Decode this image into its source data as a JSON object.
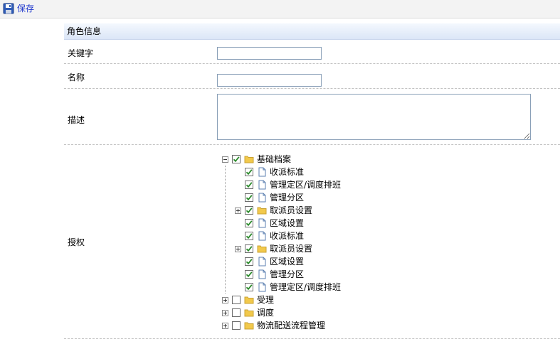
{
  "toolbar": {
    "save_label": "保存"
  },
  "section": {
    "title": "角色信息"
  },
  "fields": {
    "keyword": {
      "label": "关键字",
      "value": ""
    },
    "name": {
      "label": "名称",
      "value": ""
    },
    "description": {
      "label": "描述",
      "value": ""
    },
    "authorization": {
      "label": "授权"
    }
  },
  "tree": {
    "root": {
      "label": "基础档案",
      "checked": true,
      "expanded": true
    },
    "children": [
      {
        "label": "收派标准",
        "checked": true,
        "type": "file"
      },
      {
        "label": "管理定区/调度排班",
        "checked": true,
        "type": "file"
      },
      {
        "label": "管理分区",
        "checked": true,
        "type": "file"
      },
      {
        "label": "取派员设置",
        "checked": true,
        "type": "folder",
        "collapsed": true
      },
      {
        "label": "区域设置",
        "checked": true,
        "type": "file"
      },
      {
        "label": "收派标准",
        "checked": true,
        "type": "file"
      },
      {
        "label": "取派员设置",
        "checked": true,
        "type": "folder",
        "collapsed": true
      },
      {
        "label": "区域设置",
        "checked": true,
        "type": "file"
      },
      {
        "label": "管理分区",
        "checked": true,
        "type": "file"
      },
      {
        "label": "管理定区/调度排班",
        "checked": true,
        "type": "file"
      }
    ],
    "others": [
      {
        "label": "受理",
        "checked": false
      },
      {
        "label": "调度",
        "checked": false
      },
      {
        "label": "物流配送流程管理",
        "checked": false
      }
    ]
  },
  "colors": {
    "accent": "#1a33cc",
    "header_bg": "#dbe6f7",
    "check": "#2a8a2a",
    "folder": "#f2c94c"
  }
}
